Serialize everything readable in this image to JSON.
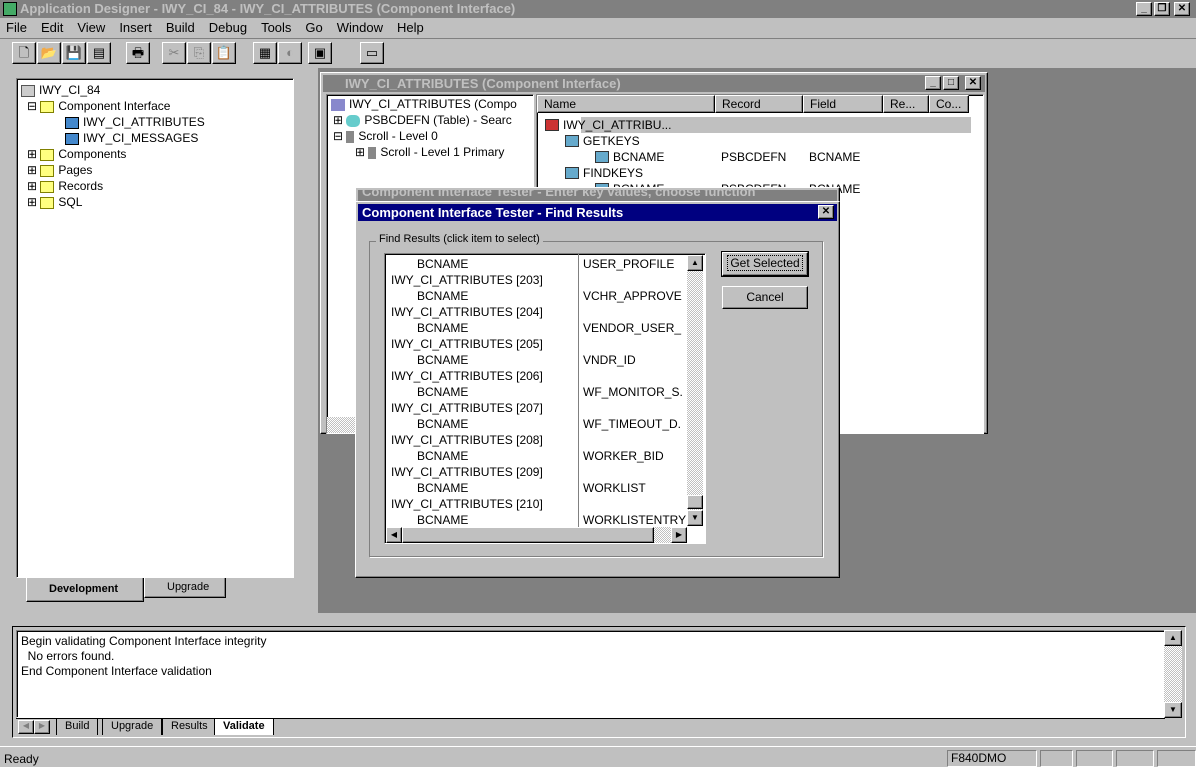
{
  "app": {
    "title": "Application Designer - IWY_CI_84 - IWY_CI_ATTRIBUTES (Component Interface)"
  },
  "menu": [
    "File",
    "Edit",
    "View",
    "Insert",
    "Build",
    "Debug",
    "Tools",
    "Go",
    "Window",
    "Help"
  ],
  "toolbar": [
    "new-icon",
    "open-icon",
    "save-icon",
    "save-all-icon",
    "print-icon",
    "cut-icon",
    "copy-icon",
    "paste-icon",
    "properties-icon",
    "object-icon",
    "test-icon",
    "project-icon"
  ],
  "project": {
    "root": "IWY_CI_84",
    "items": [
      {
        "label": "Component Interface",
        "expanded": true
      },
      {
        "label": "IWY_CI_ATTRIBUTES"
      },
      {
        "label": "IWY_CI_MESSAGES"
      },
      {
        "label": "Components"
      },
      {
        "label": "Pages"
      },
      {
        "label": "Records"
      },
      {
        "label": "SQL"
      }
    ],
    "tabs": [
      "Development",
      "Upgrade"
    ]
  },
  "ci_window": {
    "title": "IWY_CI_ATTRIBUTES (Component Interface)",
    "left_tree": [
      "IWY_CI_ATTRIBUTES (Compo",
      "PSBCDEFN (Table) - Searc",
      "Scroll - Level 0",
      "Scroll - Level 1  Primary"
    ],
    "columns": [
      "Name",
      "Record",
      "Field",
      "Re...",
      "Co..."
    ],
    "rows": [
      {
        "name": "IWY_CI_ATTRIBU...",
        "record": "",
        "field": ""
      },
      {
        "name": "GETKEYS",
        "record": "",
        "field": ""
      },
      {
        "name": "BCNAME",
        "record": "PSBCDEFN",
        "field": "BCNAME"
      },
      {
        "name": "FINDKEYS",
        "record": "",
        "field": ""
      },
      {
        "name": "BCNAME",
        "record": "PSBCDEFN",
        "field": "BCNAME"
      }
    ]
  },
  "back_dialog": {
    "title": "Component Interface Tester - Enter key values, choose function"
  },
  "dialog": {
    "title": "Component Interface Tester - Find Results",
    "group": "Find Results (click item to select)",
    "get_selected": "Get Selected",
    "cancel": "Cancel",
    "rows": [
      [
        "BCNAME",
        "USER_PROFILE"
      ],
      [
        "IWY_CI_ATTRIBUTES [203]",
        ""
      ],
      [
        "BCNAME",
        "VCHR_APPROVE"
      ],
      [
        "IWY_CI_ATTRIBUTES [204]",
        ""
      ],
      [
        "BCNAME",
        "VENDOR_USER_"
      ],
      [
        "IWY_CI_ATTRIBUTES [205]",
        ""
      ],
      [
        "BCNAME",
        "VNDR_ID"
      ],
      [
        "IWY_CI_ATTRIBUTES [206]",
        ""
      ],
      [
        "BCNAME",
        "WF_MONITOR_S."
      ],
      [
        "IWY_CI_ATTRIBUTES [207]",
        ""
      ],
      [
        "BCNAME",
        "WF_TIMEOUT_D."
      ],
      [
        "IWY_CI_ATTRIBUTES [208]",
        ""
      ],
      [
        "BCNAME",
        "WORKER_BID"
      ],
      [
        "IWY_CI_ATTRIBUTES [209]",
        ""
      ],
      [
        "BCNAME",
        "WORKLIST"
      ],
      [
        "IWY_CI_ATTRIBUTES [210]",
        ""
      ],
      [
        "BCNAME",
        "WORKLISTENTRY"
      ]
    ]
  },
  "output": {
    "lines": [
      "Begin validating Component Interface integrity",
      "  No errors found.",
      "End Component Interface validation"
    ],
    "tabs": [
      "Build",
      "Upgrade",
      "Results",
      "Validate"
    ],
    "active_tab": "Validate"
  },
  "status": {
    "text": "Ready",
    "db": "F840DMO"
  }
}
